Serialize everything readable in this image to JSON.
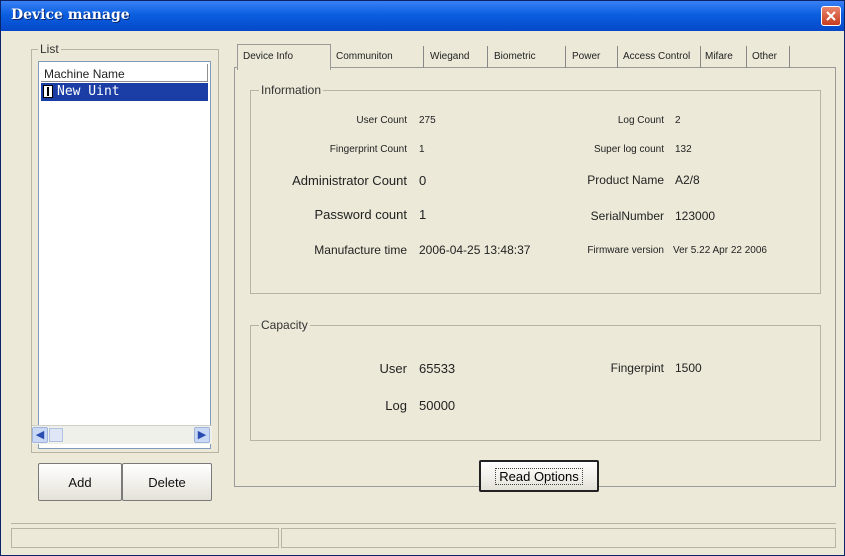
{
  "window": {
    "title": "Device manage"
  },
  "list": {
    "group_title": "List",
    "column_header": "Machine Name",
    "items": [
      {
        "label": "New Uint",
        "selected": true
      }
    ]
  },
  "buttons": {
    "add": "Add",
    "delete": "Delete",
    "read_options": "Read Options"
  },
  "tabs": [
    {
      "label": "Device Info",
      "active": true
    },
    {
      "label": "Communiton"
    },
    {
      "label": "Wiegand"
    },
    {
      "label": "Biometric"
    },
    {
      "label": "Power"
    },
    {
      "label": "Access Control"
    },
    {
      "label": "Mifare"
    },
    {
      "label": "Other"
    }
  ],
  "information": {
    "group_title": "Information",
    "left": [
      {
        "label": "User Count",
        "value": "275"
      },
      {
        "label": "Fingerprint Count",
        "value": "1"
      },
      {
        "label": "Administrator Count",
        "value": "0"
      },
      {
        "label": "Password count",
        "value": "1"
      },
      {
        "label": "Manufacture time",
        "value": "2006-04-25 13:48:37"
      }
    ],
    "right": [
      {
        "label": "Log Count",
        "value": "2"
      },
      {
        "label": "Super log count",
        "value": "132"
      },
      {
        "label": "Product Name",
        "value": "A2/8"
      },
      {
        "label": "SerialNumber",
        "value": "123000"
      },
      {
        "label": "Firmware version",
        "value": "Ver 5.22 Apr 22 2006"
      }
    ]
  },
  "capacity": {
    "group_title": "Capacity",
    "user_label": "User",
    "user_value": "65533",
    "log_label": "Log",
    "log_value": "50000",
    "fingerprint_label": "Fingerpint",
    "fingerprint_value": "1500"
  },
  "icons": {
    "close": "close-icon",
    "scroll_left": "arrow-left-icon",
    "scroll_right": "arrow-right-icon"
  },
  "colors": {
    "title_bar": "#0a5fe0",
    "selection": "#1a3ea6",
    "window_bg": "#ece9d8"
  }
}
